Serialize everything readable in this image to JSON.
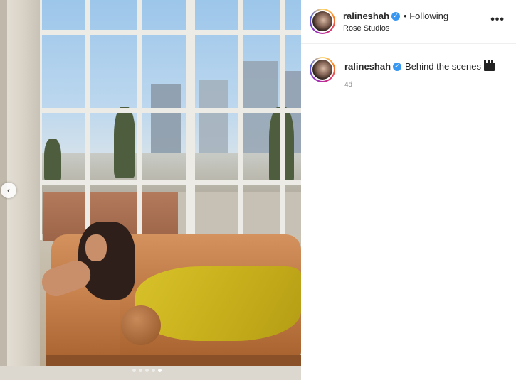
{
  "post": {
    "username": "ralineshah",
    "follow_status": "• Following",
    "location": "Rose Studios",
    "more_label": "•••"
  },
  "caption": {
    "username": "ralineshah",
    "text": "Behind the scenes",
    "emoji_icon": "clapper-board-icon",
    "time": "4d"
  },
  "carousel": {
    "total_slides": 5,
    "active_index": 4,
    "prev_label": "‹"
  },
  "colors": {
    "verified_badge": "#3897f0",
    "secondary_text": "#8e8e8e"
  }
}
